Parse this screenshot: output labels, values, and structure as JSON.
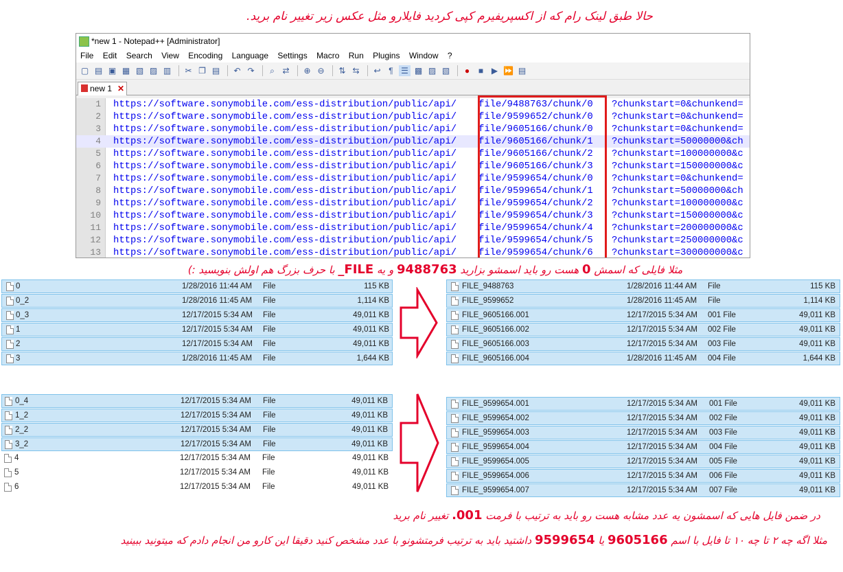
{
  "instructions": {
    "line1": "حالا طبق لینک رام که از اکسپریفیرم کپی کردید فایلارو مثل عکس زیر تغییر نام برید.",
    "line2_a": "مثلا فایلی که اسمش",
    "line2_zero": "0",
    "line2_b": "هست رو باید اسمشو بزارید",
    "line2_num": "9488763",
    "line2_c": "و یه",
    "line2_file": "_FILE",
    "line2_d": "با حرف بزرگ هم اولش بنویسید :)",
    "line3_a": "در ضمن فایل هایی که اسمشون یه عدد مشابه هست رو باید به ترتیب با فرمت",
    "line3_fmt": ".001",
    "line3_b": "تغییر نام برید",
    "line4_a": "مثلا اگه چه ۲ تا چه ۱۰ تا فایل با اسم",
    "line4_num1": "9605166",
    "line4_mid": "یا",
    "line4_num2": "9599654",
    "line4_b": "داشتید باید به ترتیب فرمتشونو با عدد مشخص کنید دقیقا این کارو من انجام دادم که میتونید ببینید"
  },
  "notepad": {
    "title": "*new 1 - Notepad++ [Administrator]",
    "menu": [
      "File",
      "Edit",
      "Search",
      "View",
      "Encoding",
      "Language",
      "Settings",
      "Macro",
      "Run",
      "Plugins",
      "Window",
      "?"
    ],
    "tab_label": "new 1",
    "highlighted_line": 4,
    "lines": [
      {
        "n": "1",
        "prefix": "https://software.sonymobile.com/ess-distribution/public/api/",
        "mid": "file/9488763/chunk/0",
        "suffix": "?chunkstart=0&chunkend="
      },
      {
        "n": "2",
        "prefix": "https://software.sonymobile.com/ess-distribution/public/api/",
        "mid": "file/9599652/chunk/0",
        "suffix": "?chunkstart=0&chunkend="
      },
      {
        "n": "3",
        "prefix": "https://software.sonymobile.com/ess-distribution/public/api/",
        "mid": "file/9605166/chunk/0",
        "suffix": "?chunkstart=0&chunkend="
      },
      {
        "n": "4",
        "prefix": "https://software.sonymobile.com/ess-distribution/public/api/",
        "mid": "file/9605166/chunk/1",
        "suffix": "?chunkstart=50000000&ch"
      },
      {
        "n": "5",
        "prefix": "https://software.sonymobile.com/ess-distribution/public/api/",
        "mid": "file/9605166/chunk/2",
        "suffix": "?chunkstart=100000000&c"
      },
      {
        "n": "6",
        "prefix": "https://software.sonymobile.com/ess-distribution/public/api/",
        "mid": "file/9605166/chunk/3",
        "suffix": "?chunkstart=150000000&c"
      },
      {
        "n": "7",
        "prefix": "https://software.sonymobile.com/ess-distribution/public/api/",
        "mid": "file/9599654/chunk/0",
        "suffix": "?chunkstart=0&chunkend="
      },
      {
        "n": "8",
        "prefix": "https://software.sonymobile.com/ess-distribution/public/api/",
        "mid": "file/9599654/chunk/1",
        "suffix": "?chunkstart=50000000&ch"
      },
      {
        "n": "9",
        "prefix": "https://software.sonymobile.com/ess-distribution/public/api/",
        "mid": "file/9599654/chunk/2",
        "suffix": "?chunkstart=100000000&c"
      },
      {
        "n": "10",
        "prefix": "https://software.sonymobile.com/ess-distribution/public/api/",
        "mid": "file/9599654/chunk/3",
        "suffix": "?chunkstart=150000000&c"
      },
      {
        "n": "11",
        "prefix": "https://software.sonymobile.com/ess-distribution/public/api/",
        "mid": "file/9599654/chunk/4",
        "suffix": "?chunkstart=200000000&c"
      },
      {
        "n": "12",
        "prefix": "https://software.sonymobile.com/ess-distribution/public/api/",
        "mid": "file/9599654/chunk/5",
        "suffix": "?chunkstart=250000000&c"
      },
      {
        "n": "13",
        "prefix": "https://software.sonymobile.com/ess-distribution/public/api/",
        "mid": "file/9599654/chunk/6",
        "suffix": "?chunkstart=300000000&c"
      }
    ]
  },
  "panels": {
    "top_left": [
      {
        "name": "0",
        "date": "1/28/2016 11:44 AM",
        "type": "File",
        "size": "115 KB",
        "selected": true
      },
      {
        "name": "0_2",
        "date": "1/28/2016 11:45 AM",
        "type": "File",
        "size": "1,114 KB",
        "selected": true
      },
      {
        "name": "0_3",
        "date": "12/17/2015 5:34 AM",
        "type": "File",
        "size": "49,011 KB",
        "selected": true
      },
      {
        "name": "1",
        "date": "12/17/2015 5:34 AM",
        "type": "File",
        "size": "49,011 KB",
        "selected": true
      },
      {
        "name": "2",
        "date": "12/17/2015 5:34 AM",
        "type": "File",
        "size": "49,011 KB",
        "selected": true
      },
      {
        "name": "3",
        "date": "1/28/2016 11:45 AM",
        "type": "File",
        "size": "1,644 KB",
        "selected": true
      }
    ],
    "top_right": [
      {
        "name": "FILE_9488763",
        "date": "1/28/2016 11:44 AM",
        "type": "File",
        "size": "115 KB",
        "selected": true
      },
      {
        "name": "FILE_9599652",
        "date": "1/28/2016 11:45 AM",
        "type": "File",
        "size": "1,114 KB",
        "selected": true
      },
      {
        "name": "FILE_9605166.001",
        "date": "12/17/2015 5:34 AM",
        "type": "001 File",
        "size": "49,011 KB",
        "selected": true
      },
      {
        "name": "FILE_9605166.002",
        "date": "12/17/2015 5:34 AM",
        "type": "002 File",
        "size": "49,011 KB",
        "selected": true
      },
      {
        "name": "FILE_9605166.003",
        "date": "12/17/2015 5:34 AM",
        "type": "003 File",
        "size": "49,011 KB",
        "selected": true
      },
      {
        "name": "FILE_9605166.004",
        "date": "1/28/2016 11:45 AM",
        "type": "004 File",
        "size": "1,644 KB",
        "selected": true
      }
    ],
    "bottom_left": [
      {
        "name": "0_4",
        "date": "12/17/2015 5:34 AM",
        "type": "File",
        "size": "49,011 KB",
        "selected": true
      },
      {
        "name": "1_2",
        "date": "12/17/2015 5:34 AM",
        "type": "File",
        "size": "49,011 KB",
        "selected": true
      },
      {
        "name": "2_2",
        "date": "12/17/2015 5:34 AM",
        "type": "File",
        "size": "49,011 KB",
        "selected": true
      },
      {
        "name": "3_2",
        "date": "12/17/2015 5:34 AM",
        "type": "File",
        "size": "49,011 KB",
        "selected": true
      },
      {
        "name": "4",
        "date": "12/17/2015 5:34 AM",
        "type": "File",
        "size": "49,011 KB",
        "selected": false
      },
      {
        "name": "5",
        "date": "12/17/2015 5:34 AM",
        "type": "File",
        "size": "49,011 KB",
        "selected": false
      },
      {
        "name": "6",
        "date": "12/17/2015 5:34 AM",
        "type": "File",
        "size": "49,011 KB",
        "selected": false
      }
    ],
    "bottom_right": [
      {
        "name": "FILE_9599654.001",
        "date": "12/17/2015 5:34 AM",
        "type": "001 File",
        "size": "49,011 KB",
        "selected": true
      },
      {
        "name": "FILE_9599654.002",
        "date": "12/17/2015 5:34 AM",
        "type": "002 File",
        "size": "49,011 KB",
        "selected": true
      },
      {
        "name": "FILE_9599654.003",
        "date": "12/17/2015 5:34 AM",
        "type": "003 File",
        "size": "49,011 KB",
        "selected": true
      },
      {
        "name": "FILE_9599654.004",
        "date": "12/17/2015 5:34 AM",
        "type": "004 File",
        "size": "49,011 KB",
        "selected": true
      },
      {
        "name": "FILE_9599654.005",
        "date": "12/17/2015 5:34 AM",
        "type": "005 File",
        "size": "49,011 KB",
        "selected": true
      },
      {
        "name": "FILE_9599654.006",
        "date": "12/17/2015 5:34 AM",
        "type": "006 File",
        "size": "49,011 KB",
        "selected": true
      },
      {
        "name": "FILE_9599654.007",
        "date": "12/17/2015 5:34 AM",
        "type": "007 File",
        "size": "49,011 KB",
        "selected": true
      }
    ]
  },
  "colors": {
    "annotation_red": "#e4002b",
    "selection_fill": "#cce6f7",
    "selection_border": "#7ec1ea",
    "link_blue": "#0000ee"
  },
  "icons": [
    "notepadpp-app-icon",
    "file-icon",
    "close-tab-icon",
    "arrow-right-outline-icon"
  ]
}
